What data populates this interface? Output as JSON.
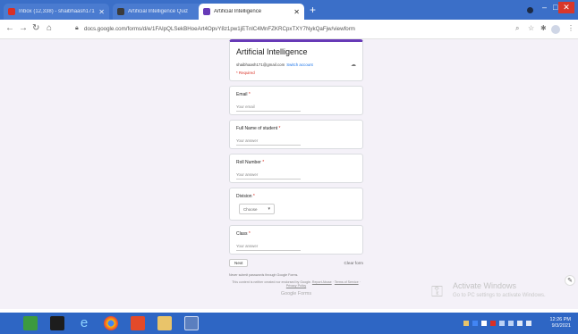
{
  "browser": {
    "tabs": [
      {
        "title": "Inbox (12,338) - shaibhaash171...",
        "favicon_color": "#d93025",
        "active": false
      },
      {
        "title": "Artificial Intelligence Quiz",
        "favicon_color": "#3b3b3b",
        "active": false
      },
      {
        "title": "Artificial Intelligence",
        "favicon_color": "#673ab7",
        "active": true
      }
    ],
    "new_tab": "+",
    "url": "docs.google.com/forms/d/e/1FAIpQLSekBHoeArt4OpvY8z1pw1jETnlC4MnFZKRCpxTXY7NykQaFjw/viewform"
  },
  "form": {
    "title": "Artificial Intelligence",
    "account_email": "shaibhaash171@gmail.com",
    "switch_account": "Switch account",
    "required_note": "* Required",
    "questions": [
      {
        "label": "Email",
        "type": "text",
        "placeholder": "Your email"
      },
      {
        "label": "Full Name of student",
        "type": "text",
        "placeholder": "Your answer"
      },
      {
        "label": "Roll Number",
        "type": "text",
        "placeholder": "Your answer"
      },
      {
        "label": "Division",
        "type": "select",
        "placeholder": "Choose"
      },
      {
        "label": "Class",
        "type": "text",
        "placeholder": "Your answer"
      }
    ],
    "next_label": "Next",
    "clear_label": "Clear form",
    "never_submit_note": "Never submit passwords through Google Forms.",
    "disclaimer": "This content is neither created nor endorsed by Google.",
    "links": [
      "Report Abuse",
      "Terms of Service",
      "Privacy Policy"
    ],
    "brand": "Google Forms"
  },
  "watermark": {
    "title": "Activate Windows",
    "subtitle": "Go to PC settings to activate Windows."
  },
  "taskbar": {
    "time": "12:26 PM",
    "date": "9/3/2021",
    "pinned": [
      "file-explorer",
      "terminal",
      "internet-explorer",
      "chrome",
      "office",
      "folder",
      "calculator"
    ]
  },
  "colors": {
    "accent": "#673ab7",
    "tabbar": "#3b6fc8",
    "taskbar": "#2e66c4",
    "required": "#d93025"
  }
}
